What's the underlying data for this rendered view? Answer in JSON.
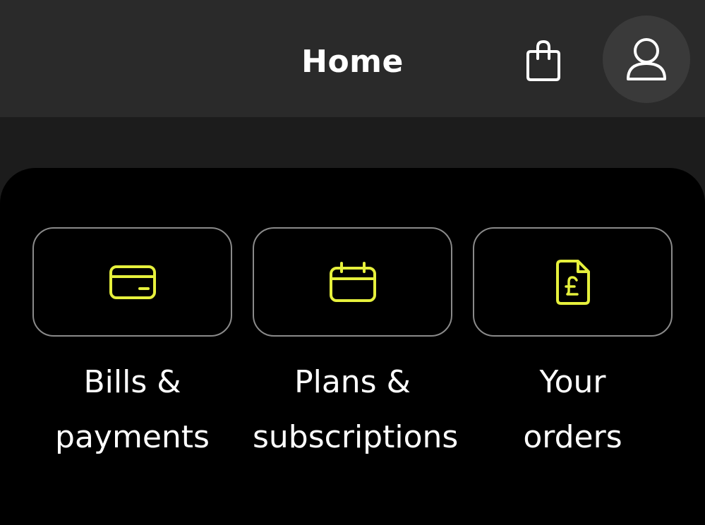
{
  "header": {
    "title": "Home",
    "bag_icon": "shopping-bag-icon",
    "account_icon": "user-icon"
  },
  "colors": {
    "accent": "#E6F03C",
    "tile_border": "#8A8A8A",
    "header_bg": "#2A2A2A",
    "panel_bg": "#000000"
  },
  "tiles": [
    {
      "icon": "credit-card-icon",
      "label_line1": "Bills &",
      "label_line2": "payments"
    },
    {
      "icon": "calendar-icon",
      "label_line1": "Plans &",
      "label_line2": "subscriptions"
    },
    {
      "icon": "pound-document-icon",
      "label_line1": "Your",
      "label_line2": "orders"
    }
  ]
}
